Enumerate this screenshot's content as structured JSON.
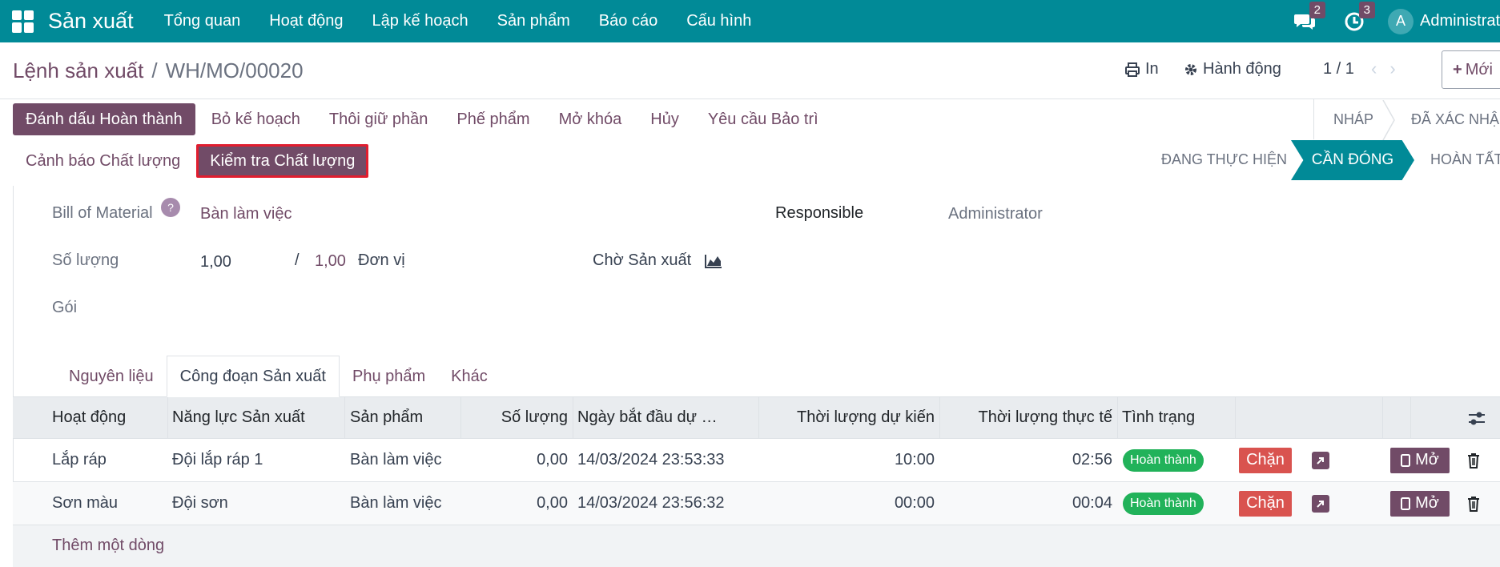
{
  "navbar": {
    "app_name": "Sản xuất",
    "menu": [
      "Tổng quan",
      "Hoạt động",
      "Lập kế hoạch",
      "Sản phẩm",
      "Báo cáo",
      "Cấu hình"
    ],
    "messages_count": "2",
    "activities_count": "3",
    "avatar_letter": "A",
    "user_name": "Administrator"
  },
  "control": {
    "breadcrumb_parent": "Lệnh sản xuất",
    "breadcrumb_sep": "/",
    "breadcrumb_current": "WH/MO/00020",
    "print_label": "In",
    "action_label": "Hành động",
    "pager": "1 / 1",
    "new_label": "Mới"
  },
  "actions": {
    "row1": [
      "Đánh dấu Hoàn thành",
      "Bỏ kế hoạch",
      "Thôi giữ phần",
      "Phế phẩm",
      "Mở khóa",
      "Hủy",
      "Yêu cầu Bảo trì"
    ],
    "row2": [
      "Cảnh báo Chất lượng",
      "Kiểm tra Chất lượng"
    ]
  },
  "status": {
    "draft": "NHÁP",
    "confirmed": "ĐÃ XÁC NHẬN",
    "in_progress": "ĐANG THỰC HIỆN",
    "to_close": "CẦN ĐÓNG",
    "done": "HOÀN TẤT"
  },
  "form": {
    "bom_label": "Bill of Material",
    "bom_help": "?",
    "bom_value": "Bàn làm việc",
    "responsible_label": "Responsible",
    "responsible_value": "Administrator",
    "qty_label": "Số lượng",
    "qty_produced": "1,00",
    "qty_sep": "/",
    "qty_total": "1,00",
    "qty_uom": "Đơn vị",
    "waiting_label": "Chờ Sản xuất",
    "package_label": "Gói"
  },
  "tabs": [
    "Nguyên liệu",
    "Công đoạn Sản xuất",
    "Phụ phẩm",
    "Khác"
  ],
  "table": {
    "headers": {
      "operation": "Hoạt động",
      "workcenter": "Năng lực Sản xuất",
      "product": "Sản phẩm",
      "qty": "Số lượng",
      "start": "Ngày bắt đầu dự …",
      "expected": "Thời lượng dự kiến",
      "real": "Thời lượng thực tế",
      "state": "Tình trạng"
    },
    "rows": [
      {
        "operation": "Lắp ráp",
        "workcenter": "Đội lắp ráp 1",
        "product": "Bàn làm việc",
        "qty": "0,00",
        "start": "14/03/2024 23:53:33",
        "expected": "10:00",
        "real": "02:56",
        "state": "Hoàn thành",
        "block": "Chặn",
        "open": "Mở"
      },
      {
        "operation": "Sơn màu",
        "workcenter": "Đội sơn",
        "product": "Bàn làm việc",
        "qty": "0,00",
        "start": "14/03/2024 23:56:32",
        "expected": "00:00",
        "real": "00:04",
        "state": "Hoàn thành",
        "block": "Chặn",
        "open": "Mở"
      }
    ],
    "add_line": "Thêm một dòng"
  }
}
